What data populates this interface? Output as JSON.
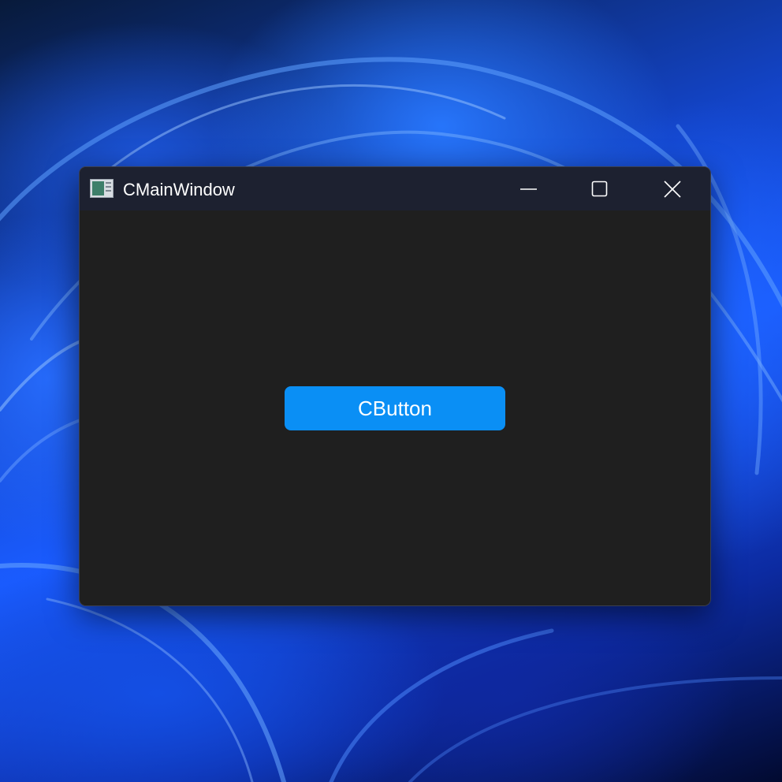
{
  "window": {
    "title": "CMainWindow",
    "controls": {
      "minimize_icon": "minimize-icon",
      "maximize_icon": "maximize-icon",
      "close_icon": "close-icon"
    }
  },
  "main": {
    "button_label": "CButton"
  },
  "colors": {
    "titlebar": "#1d2130",
    "client_area": "#1f1f1f",
    "button": "#0a8ff5",
    "text": "#ffffff"
  }
}
